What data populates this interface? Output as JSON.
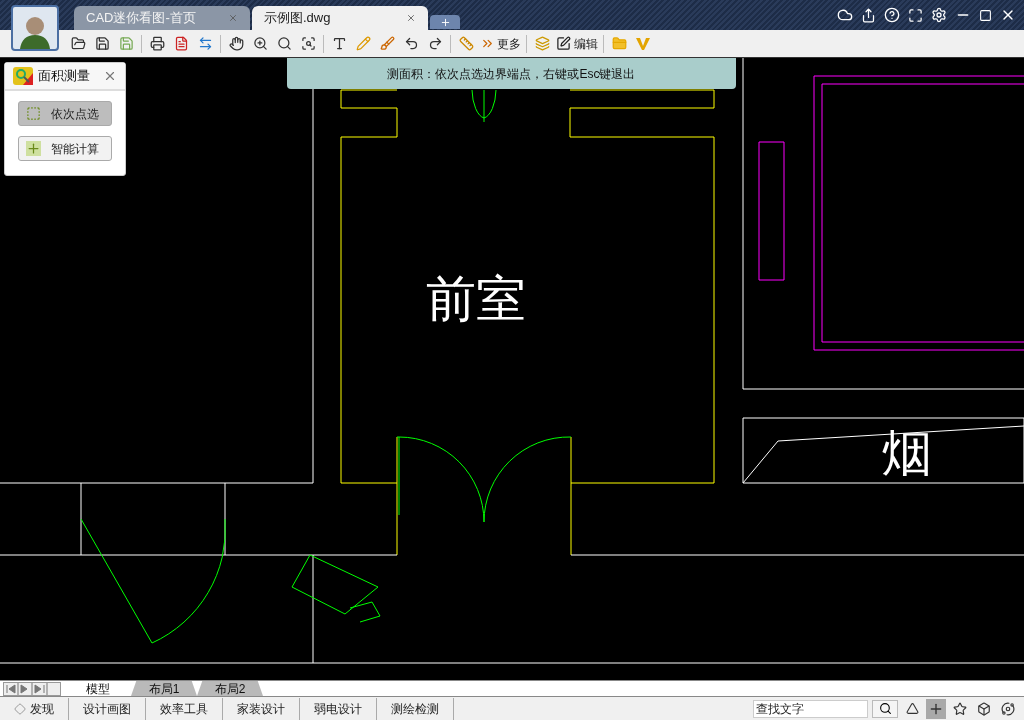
{
  "tabs": [
    {
      "title": "CAD迷你看图-首页",
      "selected": false
    },
    {
      "title": "示例图.dwg",
      "selected": true
    }
  ],
  "toolbar": {
    "more_label": "更多",
    "edit_label": "编辑"
  },
  "hint": "测面积：依次点选边界端点，右键或Esc键退出",
  "panel": {
    "title": "面积测量",
    "buttons": [
      {
        "label": "依次点选",
        "selected": true,
        "kind": "point"
      },
      {
        "label": "智能计算",
        "selected": false,
        "kind": "smart"
      }
    ]
  },
  "drawing": {
    "labels": [
      {
        "text": "前室",
        "kind": "room"
      },
      {
        "text": "烟",
        "kind": "flue"
      }
    ]
  },
  "layout_tabs": [
    {
      "label": "模型",
      "selected": true
    },
    {
      "label": "布局1",
      "selected": false
    },
    {
      "label": "布局2",
      "selected": false
    }
  ],
  "bottom_menu": [
    {
      "label": "发现",
      "kind": "discover"
    },
    {
      "label": "设计画图",
      "kind": "plain"
    },
    {
      "label": "效率工具",
      "kind": "plain"
    },
    {
      "label": "家装设计",
      "kind": "plain"
    },
    {
      "label": "弱电设计",
      "kind": "plain"
    },
    {
      "label": "测绘检测",
      "kind": "plain"
    }
  ],
  "search": {
    "placeholder": "查找文字"
  },
  "toggles": [
    {
      "kind": "ortho",
      "on": false
    },
    {
      "kind": "crosshair",
      "on": true
    },
    {
      "kind": "star",
      "on": false
    },
    {
      "kind": "cube",
      "on": false
    },
    {
      "kind": "planet",
      "on": false
    }
  ]
}
